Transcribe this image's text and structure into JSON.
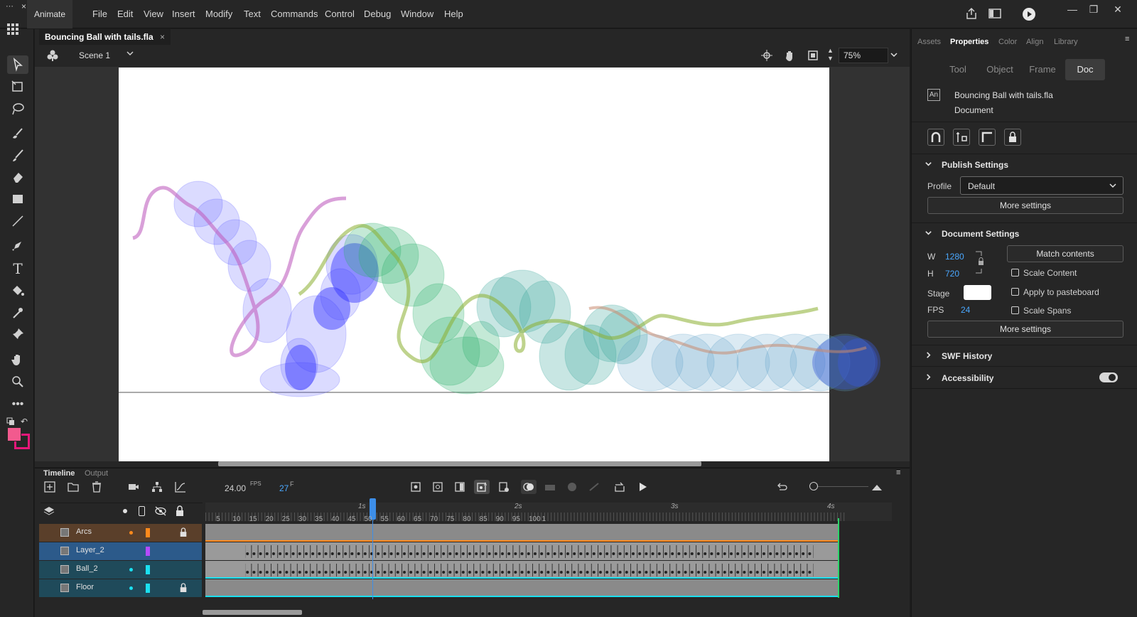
{
  "app": {
    "name": "Animate"
  },
  "menu": [
    "File",
    "Edit",
    "View",
    "Insert",
    "Modify",
    "Text",
    "Commands",
    "Control",
    "Debug",
    "Window",
    "Help"
  ],
  "document": {
    "tab_title": "Bouncing Ball with tails.fla",
    "scene": "Scene 1",
    "zoom": "75%"
  },
  "timeline": {
    "tabs": [
      "Timeline",
      "Output"
    ],
    "fps": "24.00",
    "fps_unit": "FPS",
    "frame": "27",
    "frame_unit": "F",
    "seconds": [
      "1s",
      "2s",
      "3s",
      "4s"
    ],
    "ruler": [
      "5",
      "10",
      "15",
      "20",
      "25",
      "30",
      "35",
      "40",
      "45",
      "50",
      "55",
      "60",
      "65",
      "70",
      "75",
      "80",
      "85",
      "90",
      "95",
      "100",
      "1"
    ],
    "layers": [
      {
        "name": "Arcs",
        "color": "#ff8a1c"
      },
      {
        "name": "Layer_2",
        "color": "#b44bff"
      },
      {
        "name": "Ball_2",
        "color": "#1be0f0"
      },
      {
        "name": "Floor",
        "color": "#1be0f0"
      }
    ]
  },
  "properties": {
    "panel_tabs": [
      "Assets",
      "Properties",
      "Color",
      "Align",
      "Library"
    ],
    "segments": [
      "Tool",
      "Object",
      "Frame",
      "Doc"
    ],
    "doc_name": "Bouncing Ball with tails.fla",
    "doc_type": "Document",
    "doc_icon_text": "An",
    "publish": {
      "title": "Publish Settings",
      "profile_label": "Profile",
      "profile_value": "Default",
      "more": "More settings"
    },
    "docset": {
      "title": "Document Settings",
      "w_label": "W",
      "w": "1280",
      "h_label": "H",
      "h": "720",
      "match": "Match contents",
      "scale_content": "Scale Content",
      "stage_label": "Stage",
      "apply_pasteboard": "Apply to pasteboard",
      "fps_label": "FPS",
      "fps": "24",
      "scale_spans": "Scale Spans",
      "more": "More settings"
    },
    "swf_history": "SWF History",
    "accessibility": "Accessibility"
  },
  "colors": {
    "fill": "#f25a8e",
    "stroke": "#e8177a",
    "accent": "#2d8ceb"
  }
}
